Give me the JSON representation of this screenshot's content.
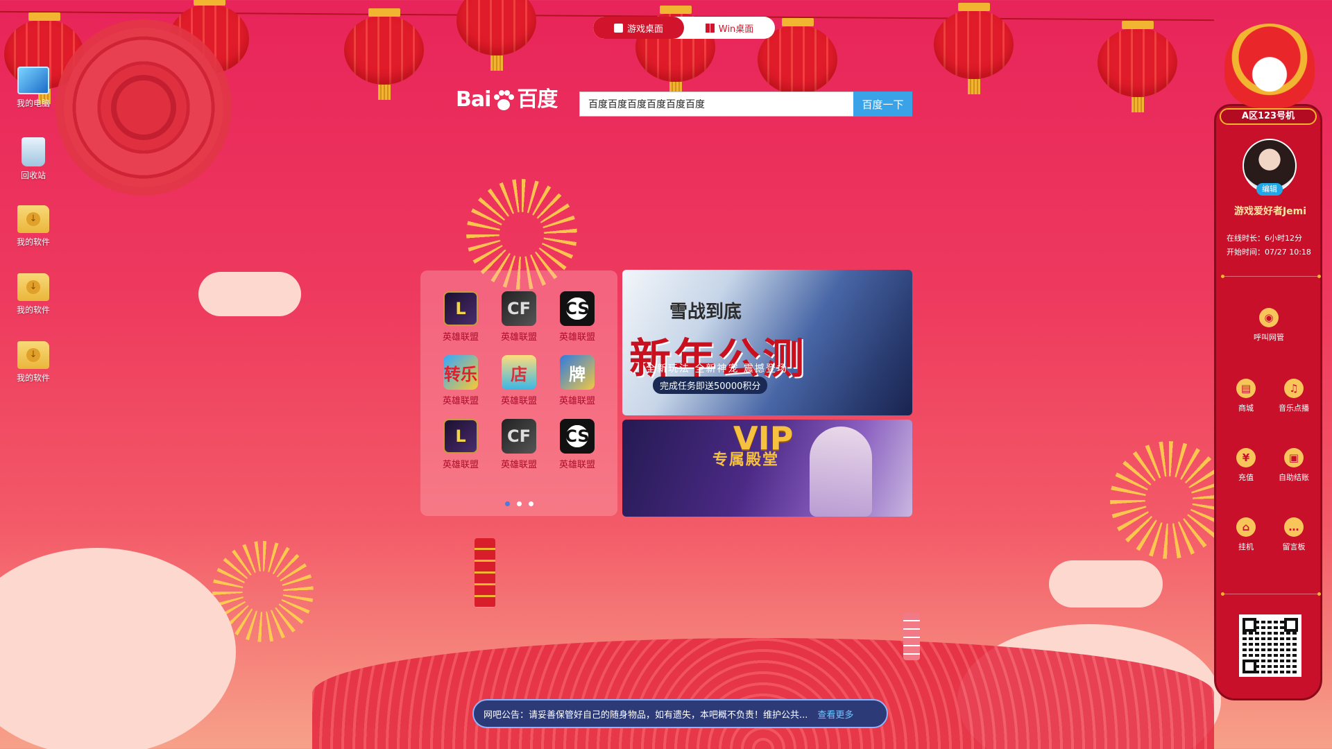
{
  "mode_toggle": {
    "game_desktop_label": "游戏桌面",
    "win_desktop_label": "Win桌面"
  },
  "desktop_icons": [
    {
      "label": "我的电脑",
      "icon": "computer-icon"
    },
    {
      "label": "回收站",
      "icon": "recycle-bin-icon"
    },
    {
      "label": "我的软件",
      "icon": "folder-icon"
    },
    {
      "label": "我的软件",
      "icon": "folder-icon"
    },
    {
      "label": "我的软件",
      "icon": "folder-icon"
    }
  ],
  "search": {
    "logo_left": "Bai",
    "logo_right": "百度",
    "value": "百度百度百度百度百度百度",
    "button_label": "百度一下"
  },
  "games": [
    {
      "label": "英雄联盟",
      "icon": "lol-icon",
      "glyph": "L"
    },
    {
      "label": "英雄联盟",
      "icon": "crossfire-icon",
      "glyph": "CF"
    },
    {
      "label": "英雄联盟",
      "icon": "counter-strike-icon",
      "glyph": "CS"
    },
    {
      "label": "英雄联盟",
      "icon": "zhuanzhuanle-icon",
      "glyph": "转乐"
    },
    {
      "label": "英雄联盟",
      "icon": "shop-icon",
      "glyph": "店"
    },
    {
      "label": "英雄联盟",
      "icon": "poker-icon",
      "glyph": "牌"
    },
    {
      "label": "英雄联盟",
      "icon": "lol-icon",
      "glyph": "L"
    },
    {
      "label": "英雄联盟",
      "icon": "crossfire-icon",
      "glyph": "CF"
    },
    {
      "label": "英雄联盟",
      "icon": "counter-strike-icon",
      "glyph": "CS"
    }
  ],
  "pager": {
    "pages": 3,
    "active": 0
  },
  "banner1": {
    "title": "雪战到底",
    "headline": "新年公测",
    "tagline": "全新玩法 全新神宠 震撼登场",
    "reward": "完成任务即送50000积分"
  },
  "banner2": {
    "vip": "VIP",
    "hall": "专属殿堂"
  },
  "sidebar": {
    "machine": "A区123号机",
    "edit_label": "编辑",
    "username": "游戏爱好者Jemi",
    "online_time": "在线时长：6小时12分",
    "start_time": "开始时间：07/27 10:18",
    "buttons": [
      {
        "label": "呼叫网管",
        "icon": "alien-icon",
        "glyph": "◉"
      },
      {
        "label": "商城",
        "icon": "basket-icon",
        "glyph": "▤"
      },
      {
        "label": "音乐点播",
        "icon": "headphones-icon",
        "glyph": "♫"
      },
      {
        "label": "充值",
        "icon": "money-bag-icon",
        "glyph": "¥"
      },
      {
        "label": "自助结账",
        "icon": "wallet-icon",
        "glyph": "▣"
      },
      {
        "label": "挂机",
        "icon": "lock-icon",
        "glyph": "⌂"
      },
      {
        "label": "留言板",
        "icon": "chat-icon",
        "glyph": "…"
      }
    ]
  },
  "notice": {
    "text": "网吧公告：请妥善保管好自己的随身物品，如有遗失，本吧概不负责！维护公共...",
    "more_label": "查看更多"
  },
  "colors": {
    "primary_red": "#d1142b",
    "search_blue": "#3aa3e7",
    "gold": "#f2b531"
  }
}
